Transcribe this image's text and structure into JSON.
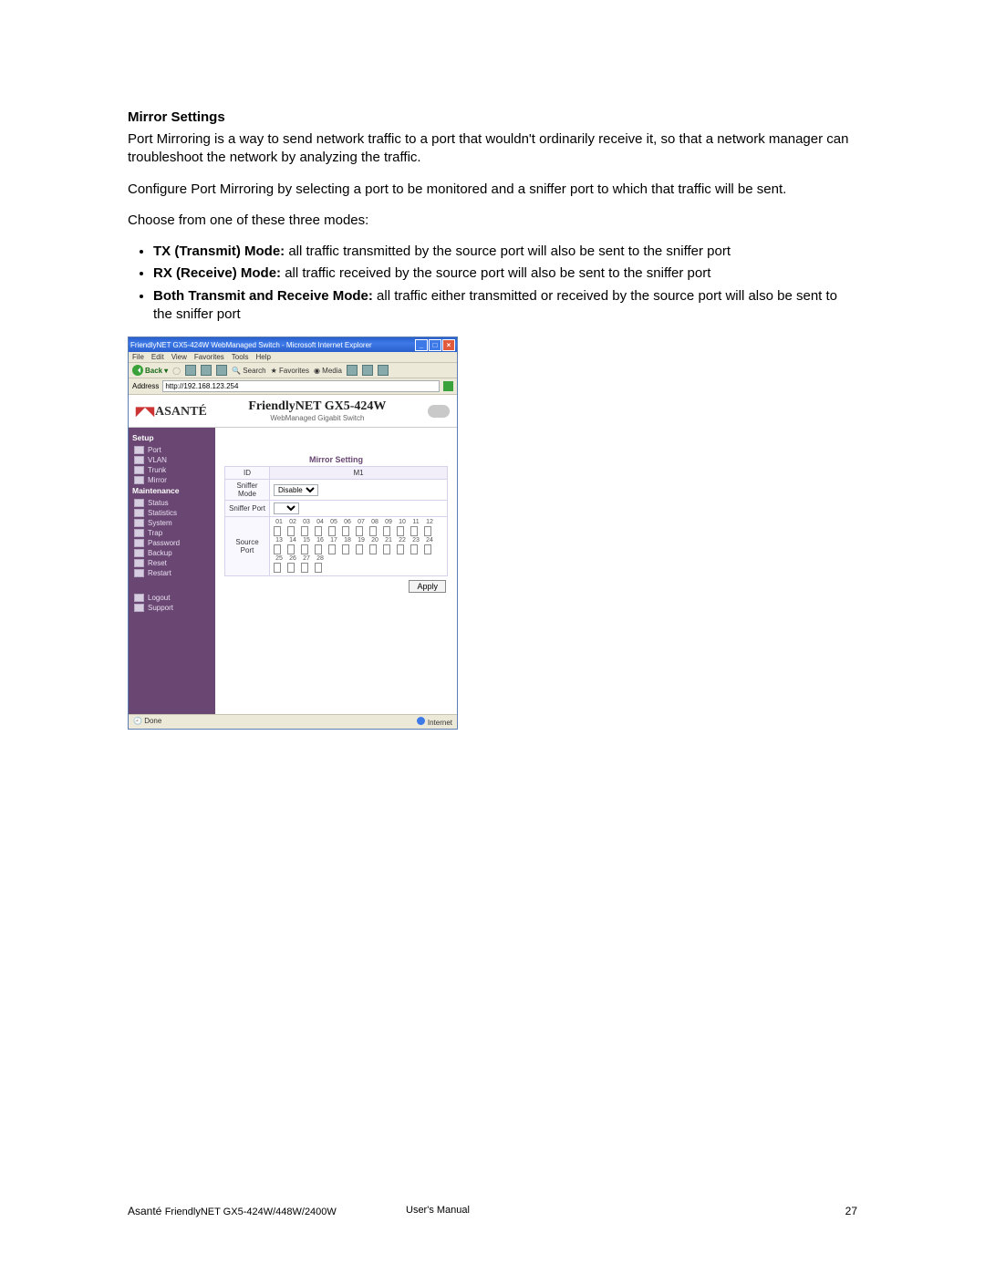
{
  "doc": {
    "section_title": "Mirror Settings",
    "p1": "Port Mirroring is a way to send network traffic to a port that wouldn't ordinarily receive it, so that a network manager can troubleshoot the network by analyzing the traffic.",
    "p2": "Configure Port Mirroring by selecting a port to be monitored and a sniffer port to which that traffic will be sent.",
    "p3": "Choose from one of these three modes:",
    "bullets": [
      {
        "b": "TX (Transmit) Mode:",
        "t": " all traffic transmitted by the source port will also be sent to the sniffer port"
      },
      {
        "b": "RX (Receive) Mode:",
        "t": " all traffic received by the source port will also be sent to the sniffer port"
      },
      {
        "b": "Both Transmit and Receive Mode:",
        "t": " all traffic either transmitted or received by the source port will also be sent to the sniffer port"
      }
    ]
  },
  "ie": {
    "title": "FriendlyNET GX5-424W WebManaged Switch - Microsoft Internet Explorer",
    "menus": [
      "File",
      "Edit",
      "View",
      "Favorites",
      "Tools",
      "Help"
    ],
    "toolbar": {
      "back": "Back",
      "search": "Search",
      "favorites": "Favorites",
      "media": "Media"
    },
    "address_label": "Address",
    "address_value": "http://192.168.123.254"
  },
  "page": {
    "logo_left": "ASANTÉ",
    "header_title": "FriendlyNET GX5-424W",
    "header_sub": "WebManaged Gigabit Switch",
    "sidebar": {
      "setup_head": "Setup",
      "setup_items": [
        "Port",
        "VLAN",
        "Trunk",
        "Mirror"
      ],
      "maint_head": "Maintenance",
      "maint_items": [
        "Status",
        "Statistics",
        "System",
        "Trap",
        "Password",
        "Backup",
        "Reset",
        "Restart"
      ],
      "bottom_items": [
        "Logout",
        "Support"
      ]
    },
    "mirror": {
      "title": "Mirror Setting",
      "id_hdr": "ID",
      "m1_hdr": "M1",
      "sniffer_mode": "Sniffer Mode",
      "sniffer_port": "Sniffer Port",
      "source_port": "Source Port",
      "mode_value": "Disable",
      "ports_r1": [
        "01",
        "02",
        "03",
        "04",
        "05",
        "06",
        "07",
        "08",
        "09",
        "10",
        "11",
        "12"
      ],
      "ports_r2": [
        "13",
        "14",
        "15",
        "16",
        "17",
        "18",
        "19",
        "20",
        "21",
        "22",
        "23",
        "24"
      ],
      "ports_r3": [
        "25",
        "26",
        "27",
        "28"
      ],
      "apply": "Apply"
    }
  },
  "status": {
    "done": "Done",
    "zone": "Internet"
  },
  "footer": {
    "left_a": "Asanté ",
    "left_b": "FriendlyNET GX5-424W/448W/2400W",
    "mid": "User's Manual",
    "right": "27"
  }
}
